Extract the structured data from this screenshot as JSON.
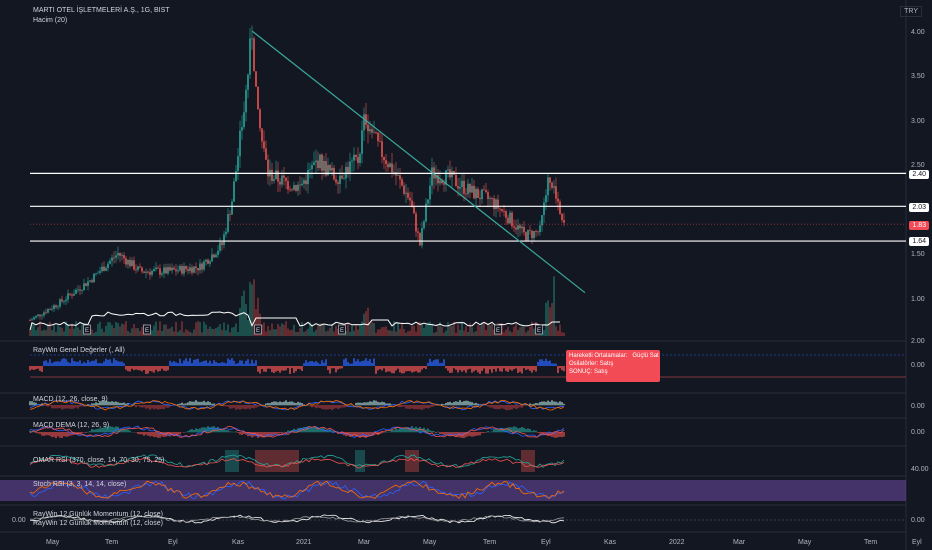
{
  "header": {
    "symbol": "MARTI OTEL İŞLETMELERİ A.Ş., 1G, BIST",
    "currency": "TRY",
    "volume_label": "Hacim (20)"
  },
  "axis": {
    "price_ticks": [
      "4.00",
      "3.50",
      "3.00",
      "2.50",
      "2.00",
      "1.50",
      "1.00"
    ],
    "bottom_vol_tick": "2.00",
    "months": [
      "May",
      "Tem",
      "Eyl",
      "Kas",
      "2021",
      "Mar",
      "May",
      "Tem",
      "Eyl",
      "Kas",
      "2022",
      "Mar",
      "May",
      "Tem",
      "Eyl"
    ]
  },
  "levels": [
    {
      "value": "2.40",
      "price": 2.4
    },
    {
      "value": "2.03",
      "price": 2.03
    },
    {
      "value": "1.83",
      "price": 1.83,
      "current": true
    },
    {
      "value": "1.64",
      "price": 1.64
    }
  ],
  "panels": [
    {
      "title": "RayWin Genel Değerler (, All)",
      "value": "0.00"
    },
    {
      "title": "MACD (12, 26, close, 9)",
      "value": "0.00"
    },
    {
      "title": "MACD DEMA (12, 26, 9)",
      "value": "0.00"
    },
    {
      "title": "OMAR RSI (370, close, 14, 70, 30, 75, 25)",
      "value": "40.00"
    },
    {
      "title": "Stoch RSI (3, 3, 14, 14, close)",
      "value": ""
    },
    {
      "title": "RayWin 12 Günlük Momentum (12, close)",
      "value": "0.00",
      "left_value": "0.00",
      "title2": "RayWin 12 Günlük Momentum (12, close)"
    }
  ],
  "tooltip": {
    "line1_label": "Hareketli Ortalamalar:",
    "line1_value": "Güçlü Sat",
    "line2": "Osilatörler: Satış",
    "line3": "SONUÇ: Satış"
  },
  "earnings_marker": "E",
  "colors": {
    "up": "#26a69a",
    "down": "#ef5350",
    "trend": "#3aa79a",
    "bg": "#131722",
    "current_price": "#f24b55"
  },
  "chart_data": {
    "type": "candlestick",
    "title": "MARTI OTEL İŞLETMELERİ A.Ş., 1G, BIST",
    "ylim": [
      0.6,
      4.1
    ],
    "key_points": [
      {
        "x": "May 2020",
        "close": 0.75
      },
      {
        "x": "Tem 2020",
        "close": 1.45
      },
      {
        "x": "Eyl 2020",
        "close": 1.35
      },
      {
        "x": "Kas 2020",
        "close": 2.2
      },
      {
        "x": "Kas 2020 peak",
        "close": 4.0
      },
      {
        "x": "2021",
        "close": 2.15
      },
      {
        "x": "Mar 2021",
        "close": 3.05
      },
      {
        "x": "May 2021",
        "close": 2.35
      },
      {
        "x": "Tem 2021",
        "close": 1.7
      },
      {
        "x": "Eyl 2021",
        "close": 2.25
      },
      {
        "x": "last",
        "close": 1.83
      }
    ],
    "trendline": {
      "from": 4.0,
      "to": 1.55
    }
  }
}
